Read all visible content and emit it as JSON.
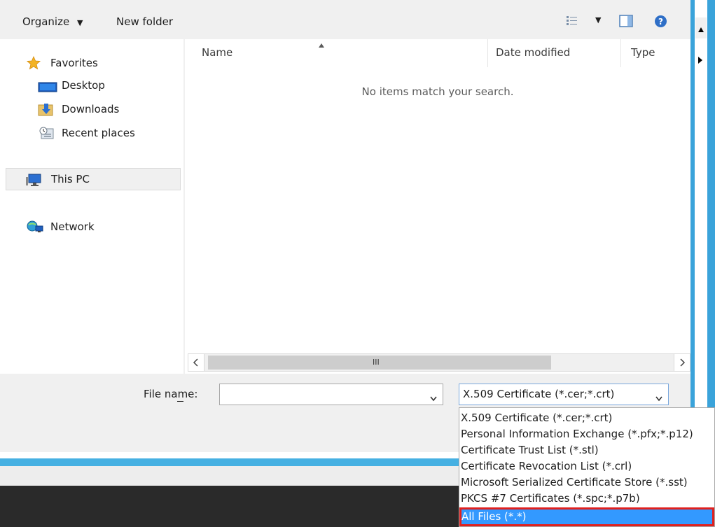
{
  "toolbar": {
    "organize_label": "Organize",
    "new_folder_label": "New folder"
  },
  "nav": {
    "favorites": "Favorites",
    "desktop": "Desktop",
    "downloads": "Downloads",
    "recent_places": "Recent places",
    "this_pc": "This PC",
    "network": "Network"
  },
  "list": {
    "columns": [
      "Name",
      "Date modified",
      "Type"
    ],
    "empty_message": "No items match your search.",
    "scroll_thumb_glyph": "III"
  },
  "footer": {
    "file_name_label": "File name:",
    "file_name_access_key": "n",
    "file_name_value": "",
    "file_type_selected": "X.509 Certificate (*.cer;*.crt)"
  },
  "dropdown": {
    "options": [
      "X.509 Certificate (*.cer;*.crt)",
      "Personal Information Exchange (*.pfx;*.p12)",
      "Certificate Trust List (*.stl)",
      "Certificate Revocation List (*.crl)",
      "Microsoft Serialized Certificate Store (*.sst)",
      "PKCS #7 Certificates (*.spc;*.p7b)",
      "All Files (*.*)"
    ],
    "highlighted_index": 6
  },
  "colors": {
    "accent": "#3aa3da",
    "highlight": "#3399ff",
    "annotation": "#e0201e"
  }
}
